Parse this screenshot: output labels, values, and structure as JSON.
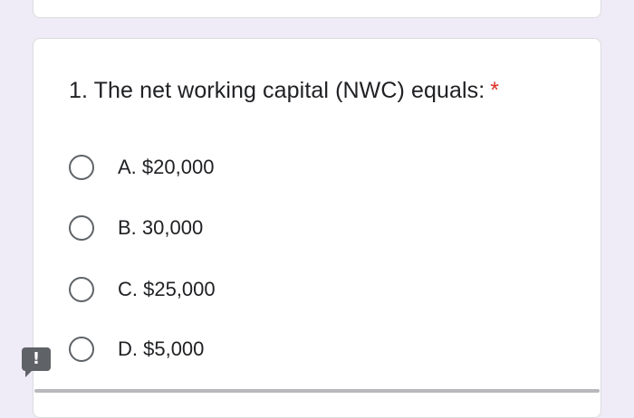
{
  "question": {
    "number_and_text": "1. The net working capital (NWC) equals:",
    "required_marker": "*"
  },
  "options": [
    {
      "label": "A. $20,000",
      "selected": false
    },
    {
      "label": "B. 30,000",
      "selected": false
    },
    {
      "label": "C. $25,000",
      "selected": false
    },
    {
      "label": "D. $5,000",
      "selected": false
    }
  ],
  "report_button": {
    "icon": "exclamation-icon",
    "glyph": "!"
  },
  "colors": {
    "page_background": "#efebf7",
    "card_background": "#ffffff",
    "required_star": "#d93025",
    "radio_border": "#5f6368"
  }
}
